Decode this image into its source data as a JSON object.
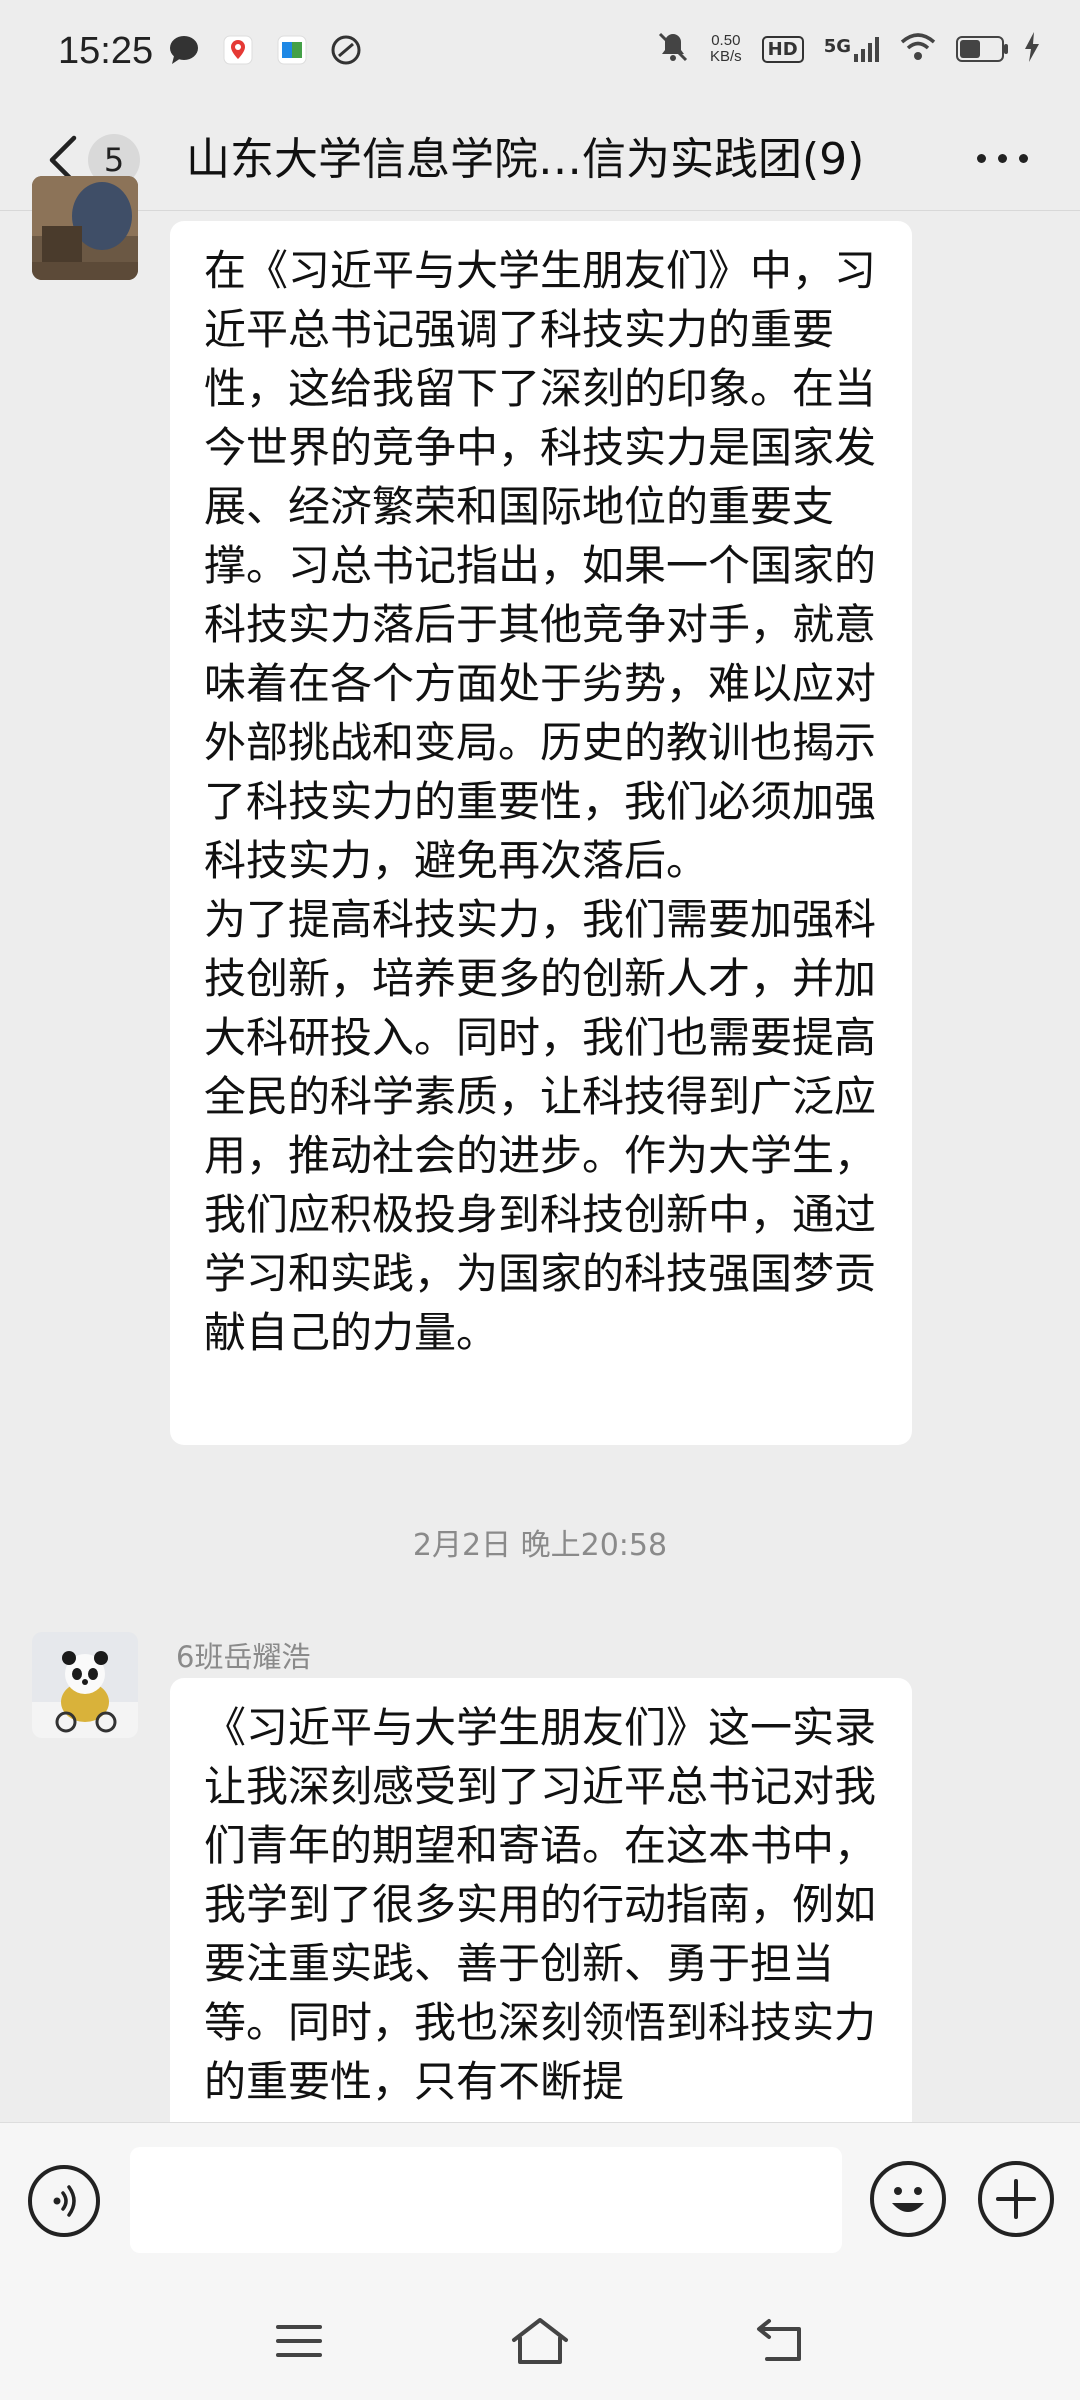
{
  "status_bar": {
    "time": "15:25",
    "network_speed_value": "0.50",
    "network_speed_unit": "KB/s",
    "hd_label": "HD",
    "signal_label": "5G",
    "battery_level": 0.5
  },
  "header": {
    "unread_count": "5",
    "title": "山东大学信息学院…信为实践团(9)"
  },
  "messages": [
    {
      "text": "在《习近平与大学生朋友们》中，习近平总书记强调了科技实力的重要性，这给我留下了深刻的印象。在当今世界的竞争中，科技实力是国家发展、经济繁荣和国际地位的重要支撑。习总书记指出，如果一个国家的科技实力落后于其他竞争对手，就意味着在各个方面处于劣势，难以应对外部挑战和变局。历史的教训也揭示了科技实力的重要性，我们必须加强科技实力，避免再次落后。\n为了提高科技实力，我们需要加强科技创新，培养更多的创新人才，并加大科研投入。同时，我们也需要提高全民的科学素质，让科技得到广泛应用，推动社会的进步。作为大学生，我们应积极投身到科技创新中，通过学习和实践，为国家的科技强国梦贡献自己的力量。"
    },
    {
      "sender": "6班岳耀浩",
      "text": "《习近平与大学生朋友们》这一实录让我深刻感受到了习近平总书记对我们青年的期望和寄语。在这本书中，我学到了很多实用的行动指南，例如要注重实践、善于创新、勇于担当等。同时，我也深刻领悟到科技实力的重要性，只有不断提"
    }
  ],
  "timestamp": "2月2日 晚上20:58",
  "input": {
    "value": "",
    "placeholder": ""
  }
}
